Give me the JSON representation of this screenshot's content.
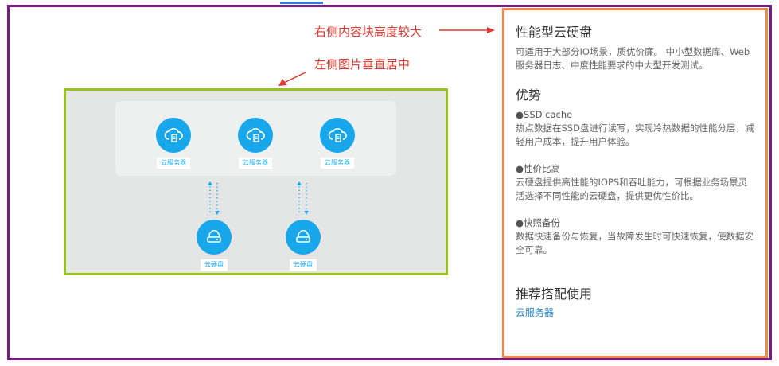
{
  "annotations": {
    "right_tall": "右侧内容块高度较大",
    "left_center": "左侧图片垂直居中"
  },
  "diagram": {
    "servers": [
      "云服务器",
      "云服务器",
      "云服务器"
    ],
    "disks": [
      "云硬盘",
      "云硬盘"
    ],
    "server_icon": "cloud-server-icon",
    "disk_icon": "cloud-disk-icon",
    "accent_color": "#17a7ea"
  },
  "product": {
    "title": "性能型云硬盘",
    "description": "可适用于大部分IO场景，质优价廉。 中小型数据库、Web服务器日志、中度性能要求的中大型开发测试。",
    "advantages_title": "优势",
    "features": [
      {
        "title": "●SSD cache",
        "text": "热点数据在SSD盘进行读写，实现冷热数据的性能分层，减轻用户成本，提升用户体验。"
      },
      {
        "title": "●性价比高",
        "text": "云硬盘提供高性能的IOPS和吞吐能力，可根据业务场景灵活选择不同性能的云硬盘，提供更优性价比。"
      },
      {
        "title": "●快照备份",
        "text": "数据快速备份与恢复，当故障发生时可快速恢复，使数据安全可靠。"
      }
    ],
    "recommend_title": "推荐搭配使用",
    "recommend_link": "云服务器"
  },
  "colors": {
    "outer_frame": "#7b1b86",
    "left_frame": "#99c31b",
    "right_frame": "#ee8a4c",
    "annotation": "#e0392f",
    "link": "#1f86d7"
  }
}
